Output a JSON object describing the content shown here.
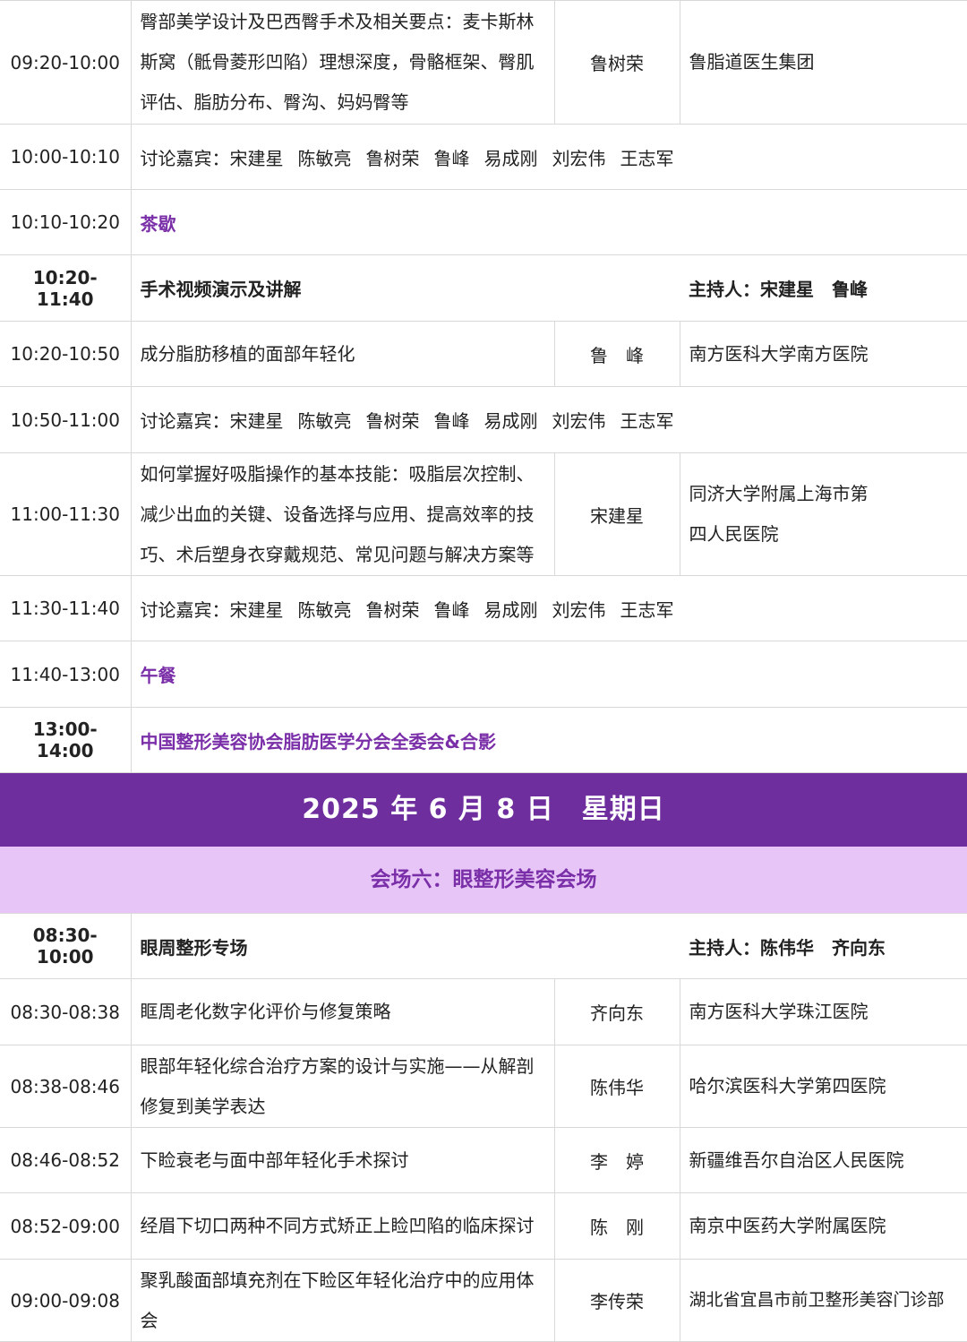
{
  "section1": {
    "r1": {
      "time": "09:20-10:00",
      "topic": "臀部美学设计及巴西臀手术及相关要点：麦卡斯林斯窝（骶骨菱形凹陷）理想深度，骨骼框架、臀肌评估、脂肪分布、臀沟、妈妈臀等",
      "speaker": "鲁树荣",
      "inst": "鲁脂道医生集团"
    },
    "r2": {
      "time": "10:00-10:10",
      "label": "讨论嘉宾：",
      "names": [
        "宋建星",
        "陈敏亮",
        "鲁树荣",
        "鲁峰",
        "易成刚",
        "刘宏伟",
        "王志军"
      ]
    },
    "r3": {
      "time": "10:10-10:20",
      "text": "茶歇"
    },
    "r4": {
      "time": "10:20-11:40",
      "title": "手术视频演示及讲解",
      "host": "主持人：宋建星　鲁峰"
    },
    "r5": {
      "time": "10:20-10:50",
      "topic": "成分脂肪移植的面部年轻化",
      "speaker": "鲁　峰",
      "inst": "南方医科大学南方医院"
    },
    "r6": {
      "time": "10:50-11:00",
      "label": "讨论嘉宾：",
      "names": [
        "宋建星",
        "陈敏亮",
        "鲁树荣",
        "鲁峰",
        "易成刚",
        "刘宏伟",
        "王志军"
      ]
    },
    "r7": {
      "time": "11:00-11:30",
      "topic": "如何掌握好吸脂操作的基本技能：吸脂层次控制、减少出血的关键、设备选择与应用、提高效率的技巧、术后塑身衣穿戴规范、常见问题与解决方案等",
      "speaker": "宋建星",
      "inst": "同济大学附属上海市第四人民医院"
    },
    "r8": {
      "time": "11:30-11:40",
      "label": "讨论嘉宾：",
      "names": [
        "宋建星",
        "陈敏亮",
        "鲁树荣",
        "鲁峰",
        "易成刚",
        "刘宏伟",
        "王志军"
      ]
    },
    "r9": {
      "time": "11:40-13:00",
      "text": "午餐"
    },
    "r10": {
      "time": "13:00-14:00",
      "text": "中国整形美容协会脂肪医学分会全委会&合影"
    }
  },
  "day_banner": "2025 年 6 月 8 日　星期日",
  "venue_banner": "会场六：眼整形美容会场",
  "section2": {
    "r1": {
      "time": "08:30-10:00",
      "title": "眼周整形专场",
      "host": "主持人：陈伟华　齐向东"
    },
    "r2": {
      "time": "08:30-08:38",
      "topic": "眶周老化数字化评价与修复策略",
      "speaker": "齐向东",
      "inst": "南方医科大学珠江医院"
    },
    "r3": {
      "time": "08:38-08:46",
      "topic": "眼部年轻化综合治疗方案的设计与实施——从解剖修复到美学表达",
      "speaker": "陈伟华",
      "inst": "哈尔滨医科大学第四医院"
    },
    "r4": {
      "time": "08:46-08:52",
      "topic": "下睑衰老与面中部年轻化手术探讨",
      "speaker": "李　婷",
      "inst": "新疆维吾尔自治区人民医院"
    },
    "r5": {
      "time": "08:52-09:00",
      "topic": "经眉下切口两种不同方式矫正上睑凹陷的临床探讨",
      "speaker": "陈　刚",
      "inst": "南京中医药大学附属医院"
    },
    "r6": {
      "time": "09:00-09:08",
      "topic": "聚乳酸面部填充剂在下睑区年轻化治疗中的应用体会",
      "speaker": "李传荣",
      "inst": "湖北省宜昌市前卫整形美容门诊部"
    }
  },
  "colors": {
    "banner": "#6e2e9e",
    "venue_bg": "#e7c6f7",
    "accent": "#7a2fa8"
  }
}
